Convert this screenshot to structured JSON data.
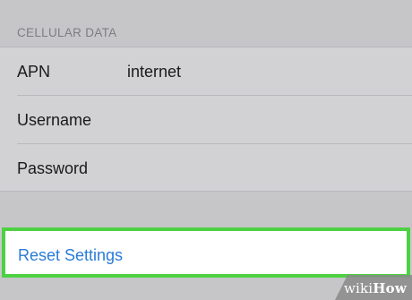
{
  "cellular": {
    "header": "CELLULAR DATA",
    "rows": [
      {
        "label": "APN",
        "value": "internet"
      },
      {
        "label": "Username",
        "value": ""
      },
      {
        "label": "Password",
        "value": ""
      }
    ]
  },
  "reset": {
    "label": "Reset Settings"
  },
  "watermark": {
    "wiki": "wiki",
    "how": "How"
  },
  "colors": {
    "highlight": "#4ed043",
    "link": "#2a7cd6"
  }
}
